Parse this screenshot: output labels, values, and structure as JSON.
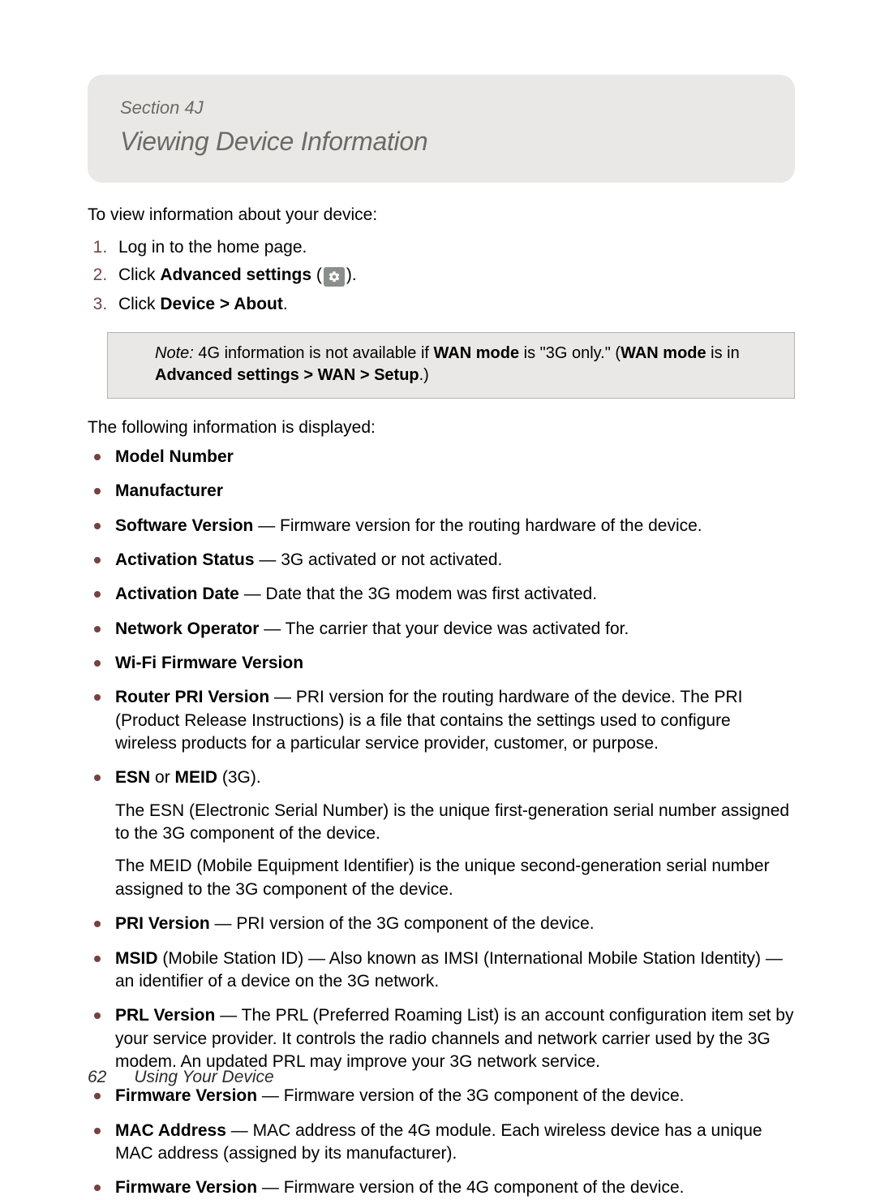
{
  "header": {
    "section_label": "Section 4J",
    "title": "Viewing Device Information"
  },
  "intro": "To view information about your device:",
  "steps": [
    {
      "prefix": "Log in to the home page."
    },
    {
      "prefix": "Click ",
      "bold": "Advanced settings",
      "paren_open": " (",
      "paren_close": ")."
    },
    {
      "prefix": "Click ",
      "bold": "Device > About",
      "suffix": "."
    }
  ],
  "note": {
    "label": "Note:",
    "t1": "  4G information is not available if ",
    "b1": "WAN mode",
    "t2": " is \"3G only.\" (",
    "b2": "WAN mode",
    "t3": " is in ",
    "b3": "Advanced settings > WAN > Setup",
    "t4": ".)"
  },
  "following": "The following information is displayed:",
  "items": {
    "model": {
      "label": "Model Number"
    },
    "mfr": {
      "label": "Manufacturer"
    },
    "swver": {
      "label": "Software Version",
      "desc": " — Firmware version for the routing hardware of the device."
    },
    "actstatus": {
      "label": "Activation Status",
      "desc": " — 3G activated or not activated."
    },
    "actdate": {
      "label": "Activation Date",
      "desc": " — Date that the 3G modem was first activated."
    },
    "netop": {
      "label": "Network Operator",
      "desc": " — The carrier that your device was activated for."
    },
    "wififw": {
      "label": "Wi-Fi Firmware Version"
    },
    "routerpri": {
      "label": "Router PRI Version",
      "desc": " — PRI version for the routing hardware of the device. The PRI (Product Release Instructions) is a file that contains the settings used to configure wireless products for a particular service provider, customer, or purpose."
    },
    "esnmeid": {
      "label1": "ESN",
      "or": " or ",
      "label2": "MEID",
      "suffix": " (3G).",
      "p1": "The ESN (Electronic Serial Number) is the unique first-generation serial number assigned to the 3G component of the device.",
      "p2": "The MEID (Mobile Equipment Identifier) is the unique second-generation serial number assigned to the 3G component of the device."
    },
    "priver": {
      "label": "PRI Version",
      "desc": " — PRI version of the 3G component of the device."
    },
    "msid": {
      "label": "MSID",
      "desc": " (Mobile Station ID) — Also known as IMSI (International Mobile Station Identity) — an identifier of a device on the 3G network."
    },
    "prlver": {
      "label": "PRL Version",
      "desc": " — The PRL (Preferred Roaming List) is an account configuration item set by your service provider. It controls the radio channels and network carrier used by the 3G modem. An updated PRL may improve your 3G network service."
    },
    "fwver3g": {
      "label": "Firmware Version",
      "desc": " — Firmware version of the 3G component of the device."
    },
    "mac": {
      "label": "MAC Address",
      "desc": " — MAC address of the 4G module. Each wireless device has a unique MAC address (assigned by its manufacturer)."
    },
    "fwver4g": {
      "label": "Firmware Version",
      "desc": " — Firmware version of the 4G component of the device."
    }
  },
  "footer": {
    "page": "62",
    "chapter": "Using Your Device"
  }
}
